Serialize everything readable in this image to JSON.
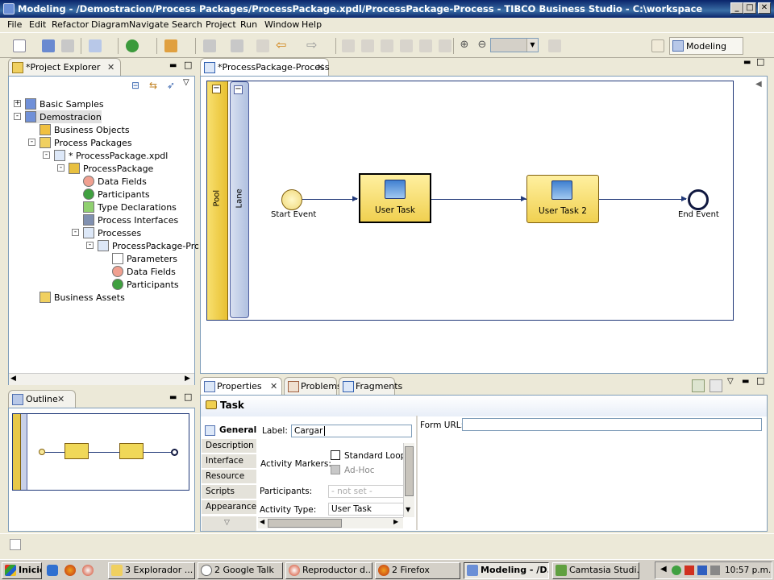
{
  "window": {
    "title": "Modeling - /Demostracion/Process Packages/ProcessPackage.xpdl/ProcessPackage-Process - TIBCO Business Studio - C:\\workspace",
    "minimize": "_",
    "maximize": "□",
    "close": "✕"
  },
  "menu": [
    "File",
    "Edit",
    "Refactor",
    "Diagram",
    "Navigate",
    "Search",
    "Project",
    "Run",
    "Window",
    "Help"
  ],
  "toolbar": {
    "perspective_label": "Modeling",
    "zoom_value": ""
  },
  "project_explorer": {
    "title": "*Project Explorer",
    "items": [
      {
        "label": "Basic Samples",
        "icon": "project-icon",
        "expander": "+"
      },
      {
        "label": "Demostracion",
        "icon": "project-icon",
        "expander": "-"
      },
      {
        "label": "Business Objects",
        "icon": "folder-objects-icon"
      },
      {
        "label": "Process Packages",
        "icon": "folder-packages-icon",
        "expander": "-"
      },
      {
        "label": "* ProcessPackage.xpdl",
        "icon": "xpdl-file-icon",
        "expander": "-"
      },
      {
        "label": "ProcessPackage",
        "icon": "package-icon",
        "expander": "-"
      },
      {
        "label": "Data Fields",
        "icon": "data-field-icon"
      },
      {
        "label": "Participants",
        "icon": "participant-icon"
      },
      {
        "label": "Type Declarations",
        "icon": "type-declaration-icon"
      },
      {
        "label": "Process Interfaces",
        "icon": "process-interface-icon"
      },
      {
        "label": "Processes",
        "icon": "processes-icon",
        "expander": "-"
      },
      {
        "label": "ProcessPackage-Proce",
        "icon": "process-icon",
        "expander": "-"
      },
      {
        "label": "Parameters",
        "icon": "parameter-icon"
      },
      {
        "label": "Data Fields",
        "icon": "data-field-icon"
      },
      {
        "label": "Participants",
        "icon": "participant-icon"
      },
      {
        "label": "Business Assets",
        "icon": "folder-assets-icon"
      }
    ]
  },
  "outline": {
    "title": "Outline"
  },
  "editor": {
    "tab": "*ProcessPackage-Process",
    "pool_label": "Pool",
    "lane_label": "Lane",
    "start_event": "Start Event",
    "task1": "User Task",
    "task2": "User Task 2",
    "end_event": "End Event"
  },
  "properties": {
    "tabs": [
      "Properties",
      "Problems",
      "Fragments"
    ],
    "header": "Task",
    "sections": [
      "General",
      "Description",
      "Interface",
      "Resource",
      "Scripts",
      "Appearance"
    ],
    "label_caption": "Label:",
    "label_value": "Cargar",
    "activity_markers_caption": "Activity Markers:",
    "standard_loop": "Standard Loop",
    "ad_hoc": "Ad-Hoc",
    "participants_caption": "Participants:",
    "participants_placeholder": "- not set -",
    "activity_type_caption": "Activity Type:",
    "activity_type_value": "User Task",
    "form_url_caption": "Form URL:"
  },
  "taskbar": {
    "start": "Inicio",
    "tasks": [
      {
        "label": "3 Explorador ...",
        "icon": "folder-icon"
      },
      {
        "label": "2 Google Talk",
        "icon": "chat-icon"
      },
      {
        "label": "Reproductor d...",
        "icon": "media-icon"
      },
      {
        "label": "2 Firefox",
        "icon": "firefox-icon"
      },
      {
        "label": "Modeling - /D...",
        "icon": "eclipse-icon",
        "active": true
      },
      {
        "label": "Camtasia Studi...",
        "icon": "camtasia-icon"
      }
    ],
    "clock": "10:57 p.m."
  }
}
